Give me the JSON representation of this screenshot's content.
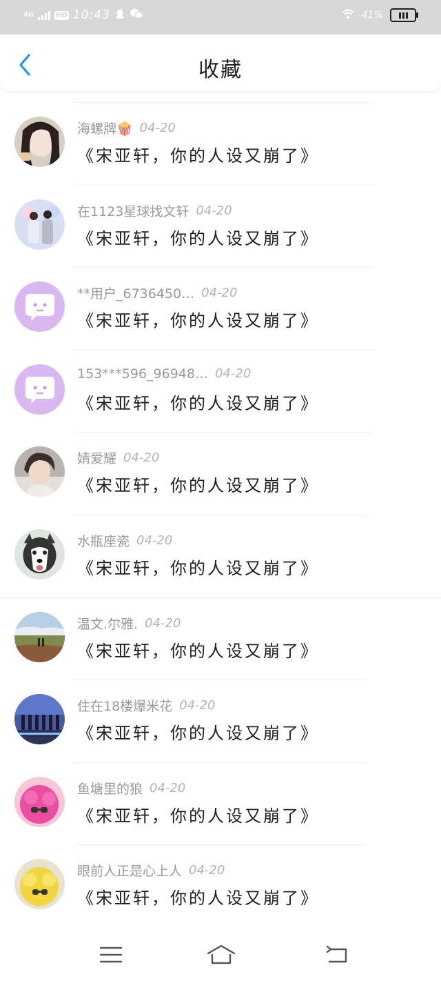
{
  "status_bar": {
    "network": "4G",
    "hd": "HD",
    "time": "10:43",
    "battery_pct": "41%",
    "icons": [
      "signal-icon",
      "qq-icon",
      "wechat-icon",
      "wifi-icon",
      "battery-icon"
    ]
  },
  "header": {
    "title": "收藏",
    "back_icon": "chevron-left-icon"
  },
  "accent_color": "#2196f3",
  "favorites": [
    {
      "user": "海螺牌🍿",
      "date": "04-20",
      "text": "《宋亚轩，你的人设又崩了》"
    },
    {
      "user": "在1123星球找文轩",
      "date": "04-20",
      "text": "《宋亚轩，你的人设又崩了》"
    },
    {
      "user": "**用户_6736450…",
      "date": "04-20",
      "text": "《宋亚轩，你的人设又崩了》"
    },
    {
      "user": "153***596_96948…",
      "date": "04-20",
      "text": "《宋亚轩，你的人设又崩了》"
    },
    {
      "user": "婧爱耀",
      "date": "04-20",
      "text": "《宋亚轩，你的人设又崩了》"
    },
    {
      "user": "水瓶座瓷",
      "date": "04-20",
      "text": "《宋亚轩，你的人设又崩了》"
    },
    {
      "user": "温文.尔雅.",
      "date": "04-20",
      "text": "《宋亚轩，你的人设又崩了》"
    },
    {
      "user": "住在18楼爆米花",
      "date": "04-20",
      "text": "《宋亚轩，你的人设又崩了》"
    },
    {
      "user": "鱼塘里的狼",
      "date": "04-20",
      "text": "《宋亚轩，你的人设又崩了》"
    },
    {
      "user": "眼前人正是心上人",
      "date": "04-20",
      "text": "《宋亚轩，你的人设又崩了》"
    }
  ],
  "nav_bar": {
    "icons": [
      "menu-icon",
      "home-icon",
      "back-icon"
    ]
  }
}
